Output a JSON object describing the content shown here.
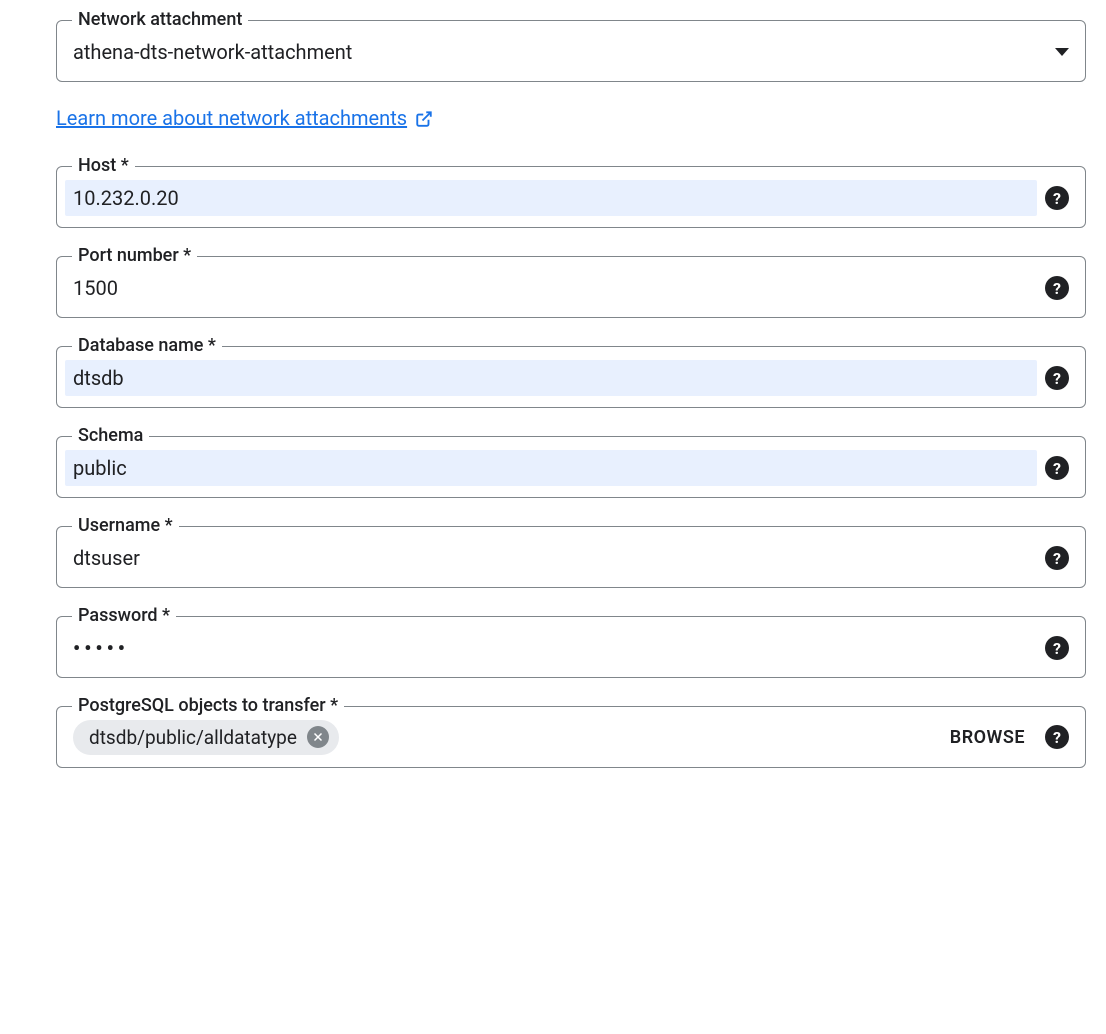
{
  "networkAttachment": {
    "label": "Network attachment",
    "value": "athena-dts-network-attachment"
  },
  "learnMore": {
    "text": "Learn more about network attachments"
  },
  "host": {
    "label": "Host *",
    "value": "10.232.0.20"
  },
  "port": {
    "label": "Port number *",
    "value": "1500"
  },
  "database": {
    "label": "Database name *",
    "value": "dtsdb"
  },
  "schema": {
    "label": "Schema",
    "value": "public"
  },
  "username": {
    "label": "Username *",
    "value": "dtsuser"
  },
  "password": {
    "label": "Password *",
    "value": "•••••"
  },
  "objects": {
    "label": "PostgreSQL objects to transfer *",
    "chip": "dtsdb/public/alldatatype",
    "browse": "BROWSE"
  }
}
